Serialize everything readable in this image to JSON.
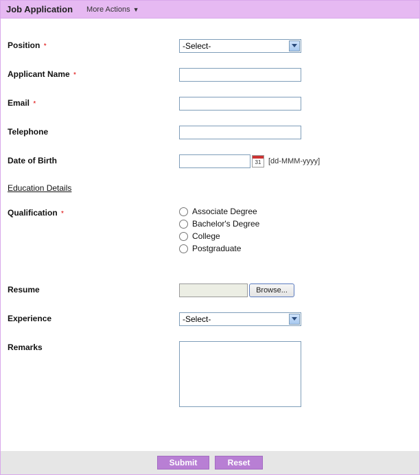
{
  "header": {
    "title": "Job Application",
    "more_actions": "More Actions"
  },
  "labels": {
    "position": "Position",
    "applicant_name": "Applicant Name",
    "email": "Email",
    "telephone": "Telephone",
    "dob": "Date of Birth",
    "education_section": "Education Details",
    "qualification": "Qualification",
    "resume": "Resume",
    "experience": "Experience",
    "remarks": "Remarks"
  },
  "required_mark": "*",
  "select_placeholder": "-Select-",
  "date_hint": "[dd-MMM-yyyy]",
  "calendar_day": "31",
  "qualification_options": {
    "o1": "Associate Degree",
    "o2": "Bachelor's Degree",
    "o3": "College",
    "o4": "Postgraduate"
  },
  "browse_label": "Browse...",
  "buttons": {
    "submit": "Submit",
    "reset": "Reset"
  },
  "values": {
    "position": "-Select-",
    "applicant_name": "",
    "email": "",
    "telephone": "",
    "dob": "",
    "resume_filename": "",
    "experience": "-Select-",
    "remarks": ""
  }
}
